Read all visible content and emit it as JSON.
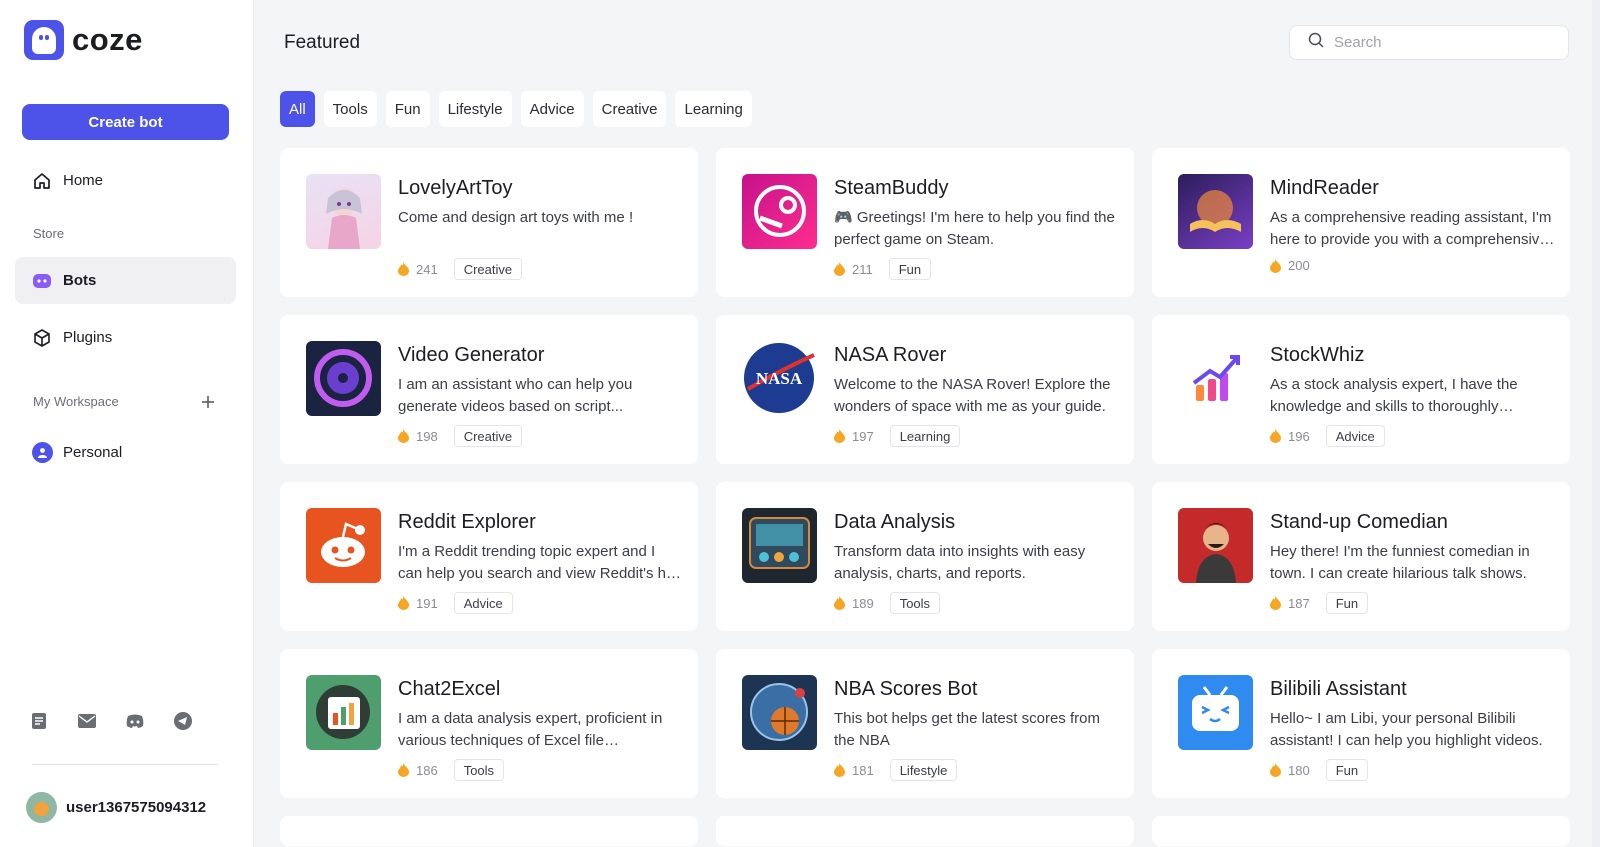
{
  "brand": {
    "name": "coze",
    "color": "#4d53e8"
  },
  "sidebar": {
    "create_label": "Create bot",
    "home_label": "Home",
    "store_label": "Store",
    "bots_label": "Bots",
    "plugins_label": "Plugins",
    "workspace_label": "My Workspace",
    "personal_label": "Personal",
    "footer_icons": [
      "document-icon",
      "mail-icon",
      "discord-icon",
      "telegram-icon"
    ],
    "user_name": "user1367575094312"
  },
  "header": {
    "title": "Featured",
    "search_placeholder": "Search"
  },
  "tabs": [
    {
      "label": "All",
      "active": true
    },
    {
      "label": "Tools",
      "active": false
    },
    {
      "label": "Fun",
      "active": false
    },
    {
      "label": "Lifestyle",
      "active": false
    },
    {
      "label": "Advice",
      "active": false
    },
    {
      "label": "Creative",
      "active": false
    },
    {
      "label": "Learning",
      "active": false
    }
  ],
  "bots": [
    {
      "name": "LovelyArtToy",
      "desc": "Come and design art toys with me !",
      "count": "241",
      "category": "Creative"
    },
    {
      "name": "SteamBuddy",
      "desc": "🎮 Greetings! I'm here to help you find the perfect game on Steam.",
      "count": "211",
      "category": "Fun"
    },
    {
      "name": "MindReader",
      "desc": "As a comprehensive reading assistant, I'm here to provide you with a comprehensive reading experience.",
      "count": "200",
      "category": ""
    },
    {
      "name": "Video Generator",
      "desc": "I am an assistant who can help you generate videos based on script...",
      "count": "198",
      "category": "Creative"
    },
    {
      "name": "NASA Rover",
      "desc": "Welcome to the NASA Rover! Explore the wonders of space with me as your guide.",
      "count": "197",
      "category": "Learning"
    },
    {
      "name": "StockWhiz",
      "desc": "As a stock analysis expert, I have the knowledge and skills to thoroughly analyze.",
      "count": "196",
      "category": "Advice"
    },
    {
      "name": "Reddit Explorer",
      "desc": "I'm a Reddit trending topic expert and I can help you search and view Reddit's hot topics.",
      "count": "191",
      "category": "Advice"
    },
    {
      "name": "Data Analysis",
      "desc": "Transform data into insights with easy analysis, charts, and reports.",
      "count": "189",
      "category": "Tools"
    },
    {
      "name": "Stand-up Comedian",
      "desc": "Hey there! I'm the funniest comedian in town. I can create hilarious talk shows.",
      "count": "187",
      "category": "Fun"
    },
    {
      "name": "Chat2Excel",
      "desc": "I am a data analysis expert, proficient in various techniques of Excel file processing.",
      "count": "186",
      "category": "Tools"
    },
    {
      "name": "NBA Scores Bot",
      "desc": "This bot helps get the latest scores from the NBA",
      "count": "181",
      "category": "Lifestyle"
    },
    {
      "name": "Bilibili Assistant",
      "desc": "Hello~ I am Libi, your personal Bilibili assistant! I can help you highlight videos.",
      "count": "180",
      "category": "Fun"
    }
  ]
}
